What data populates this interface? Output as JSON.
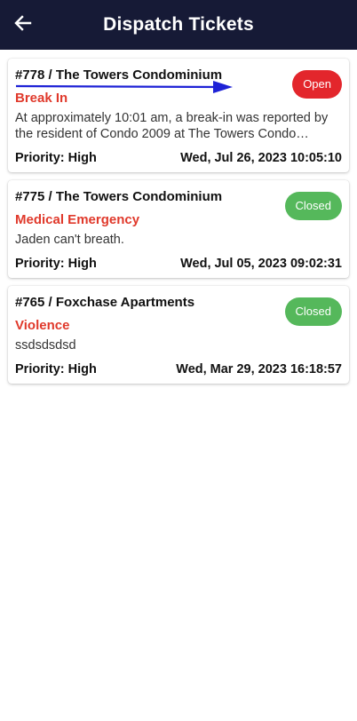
{
  "header": {
    "title": "Dispatch Tickets",
    "back_icon": "arrow-left-icon"
  },
  "colors": {
    "appbar": "#161a36",
    "open_badge": "#e3262c",
    "closed_badge": "#55b85b",
    "category": "#e0392b",
    "annotation_arrow": "#1e22d6"
  },
  "tickets": [
    {
      "title": "#778 / The Towers Condominium",
      "status": "Open",
      "category": "Break In",
      "description": "At approximately 10:01 am, a break-in was reported by the resident of Condo 2009 at The Towers Condo…",
      "priority": "Priority: High",
      "datetime": "Wed, Jul 26, 2023 10:05:10"
    },
    {
      "title": "#775 / The Towers Condominium",
      "status": "Closed",
      "category": "Medical Emergency",
      "description": "Jaden can't breath.",
      "priority": "Priority: High",
      "datetime": "Wed, Jul 05, 2023 09:02:31"
    },
    {
      "title": "#765 / Foxchase Apartments",
      "status": "Closed",
      "category": "Violence",
      "description": "ssdsdsdsd",
      "priority": "Priority: High",
      "datetime": "Wed, Mar 29, 2023 16:18:57"
    }
  ]
}
